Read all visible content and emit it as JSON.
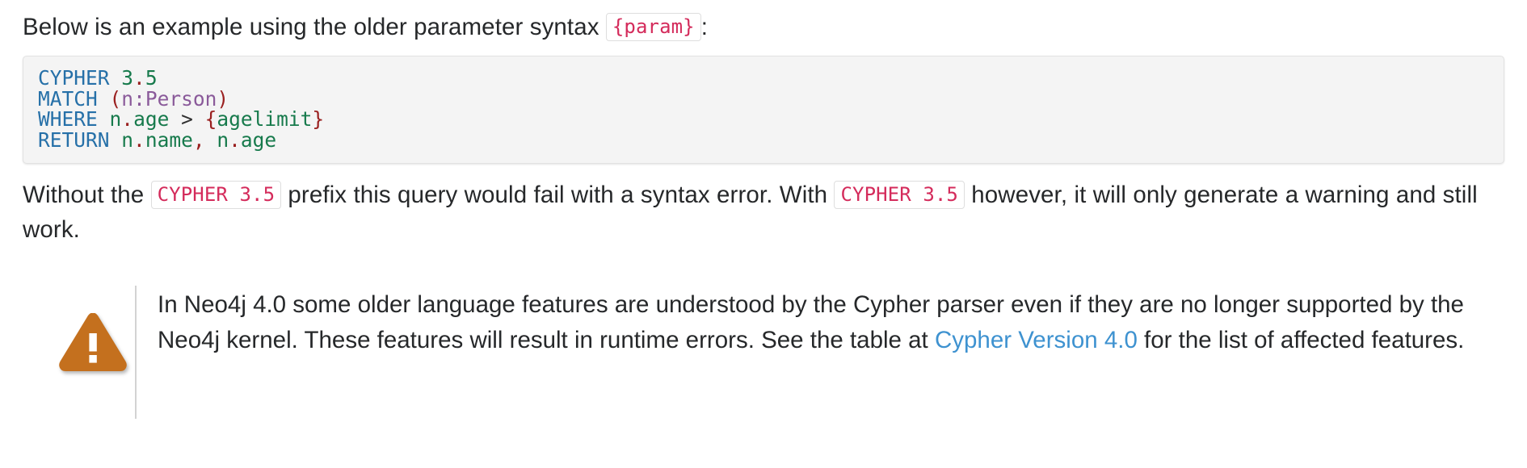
{
  "intro": {
    "text_before": "Below is an example using the older parameter syntax ",
    "code_chip": "{param}",
    "text_after": ":"
  },
  "code_block": {
    "language": "cypher",
    "lines": [
      {
        "tokens": [
          {
            "text": "CYPHER",
            "type": "keyword"
          },
          {
            "text": " ",
            "type": "plain"
          },
          {
            "text": "3",
            "type": "number"
          },
          {
            "text": ".",
            "type": "punctuation"
          },
          {
            "text": "5",
            "type": "number"
          }
        ]
      },
      {
        "tokens": [
          {
            "text": "MATCH",
            "type": "keyword"
          },
          {
            "text": " ",
            "type": "plain"
          },
          {
            "text": "(",
            "type": "punctuation"
          },
          {
            "text": "n",
            "type": "label"
          },
          {
            "text": ":",
            "type": "label"
          },
          {
            "text": "Person",
            "type": "label"
          },
          {
            "text": ")",
            "type": "punctuation"
          }
        ]
      },
      {
        "tokens": [
          {
            "text": "WHERE",
            "type": "keyword"
          },
          {
            "text": " ",
            "type": "plain"
          },
          {
            "text": "n",
            "type": "variable"
          },
          {
            "text": ".",
            "type": "punctuation"
          },
          {
            "text": "age",
            "type": "variable"
          },
          {
            "text": " ",
            "type": "plain"
          },
          {
            "text": ">",
            "type": "operator"
          },
          {
            "text": " ",
            "type": "plain"
          },
          {
            "text": "{",
            "type": "punctuation"
          },
          {
            "text": "agelimit",
            "type": "param"
          },
          {
            "text": "}",
            "type": "punctuation"
          }
        ]
      },
      {
        "tokens": [
          {
            "text": "RETURN",
            "type": "keyword"
          },
          {
            "text": " ",
            "type": "plain"
          },
          {
            "text": "n",
            "type": "variable"
          },
          {
            "text": ".",
            "type": "punctuation"
          },
          {
            "text": "name",
            "type": "variable"
          },
          {
            "text": ",",
            "type": "punctuation"
          },
          {
            "text": " ",
            "type": "plain"
          },
          {
            "text": "n",
            "type": "variable"
          },
          {
            "text": ".",
            "type": "punctuation"
          },
          {
            "text": "age",
            "type": "variable"
          }
        ]
      }
    ]
  },
  "paragraph_after": {
    "segment_1": "Without the ",
    "code_chip_1": "CYPHER 3.5",
    "segment_2": " prefix this query would fail with a syntax error. With ",
    "code_chip_2": "CYPHER 3.5",
    "segment_3": " however, it will only generate a warning and still work."
  },
  "admonition": {
    "kind": "caution",
    "icon": "warning-triangle-icon",
    "icon_color": "#c4701e",
    "segment_1": "In Neo4j 4.0 some older language features are understood by the Cypher parser even if they are no longer supported by the Neo4j kernel. These features will result in runtime errors. See the table at ",
    "link_text": "Cypher Version 4.0",
    "link_color": "#3e92d0",
    "segment_2": " for the list of affected features."
  }
}
